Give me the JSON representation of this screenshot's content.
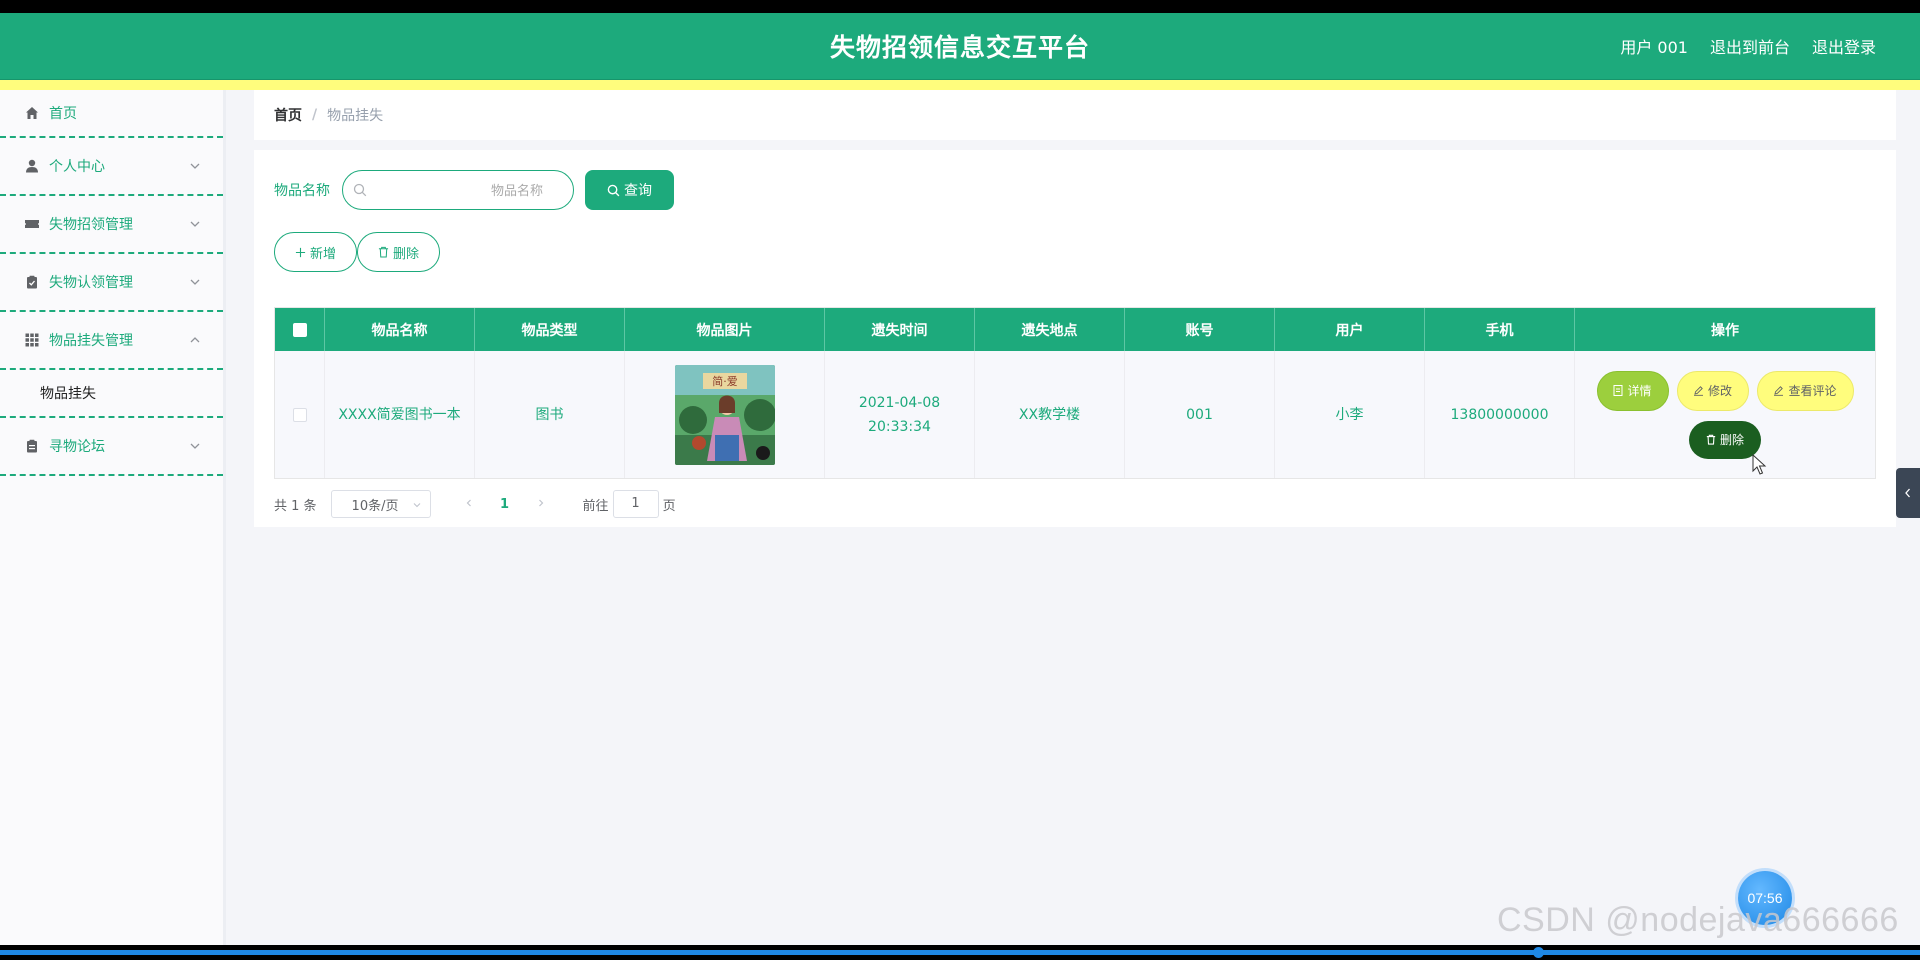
{
  "header": {
    "title": "失物招领信息交互平台",
    "nav": [
      "用户 001",
      "退出到前台",
      "退出登录"
    ]
  },
  "sidebar": {
    "items": [
      {
        "label": "首页",
        "icon": "home-icon"
      },
      {
        "label": "个人中心",
        "icon": "user-icon"
      },
      {
        "label": "失物招领管理",
        "icon": "ticket-icon"
      },
      {
        "label": "失物认领管理",
        "icon": "clipboard-check-icon"
      },
      {
        "label": "物品挂失管理",
        "icon": "grid-icon"
      },
      {
        "label": "寻物论坛",
        "icon": "clipboard-icon"
      }
    ],
    "sub_item": "物品挂失"
  },
  "breadcrumb": {
    "home": "首页",
    "separator": "/",
    "current": "物品挂失"
  },
  "search": {
    "label": "物品名称",
    "placeholder": "物品名称",
    "button": "查询"
  },
  "actions": {
    "add": "新增",
    "delete": "删除"
  },
  "table": {
    "columns": [
      "物品名称",
      "物品类型",
      "物品图片",
      "遗失时间",
      "遗失地点",
      "账号",
      "用户",
      "手机",
      "操作"
    ],
    "rows": [
      {
        "name": "XXXX简爱图书一本",
        "type": "图书",
        "time": "2021-04-08 20:33:34",
        "place": "XX教学楼",
        "account": "001",
        "user": "小李",
        "phone": "13800000000",
        "ops": {
          "detail": "详情",
          "edit": "修改",
          "comment": "查看评论",
          "delete": "删除"
        }
      }
    ]
  },
  "pagination": {
    "total": "共 1 条",
    "page_size": "10条/页",
    "current": "1",
    "goto_prefix": "前往",
    "goto_value": "1",
    "goto_suffix": "页"
  },
  "overlay": {
    "timer": "07:56",
    "watermark": "CSDN @nodejava666666"
  },
  "colors": {
    "primary": "#1daa7c",
    "accent_yellow": "#fffd7d",
    "detail_green": "#9ccf3d",
    "delete_dark": "#1b5e20"
  }
}
